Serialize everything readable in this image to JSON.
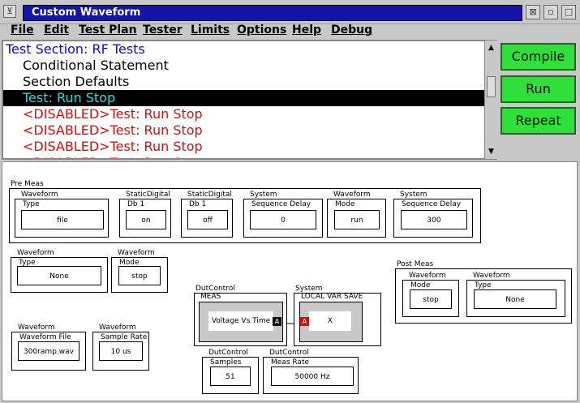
{
  "window": {
    "title": "Custom Waveform"
  },
  "menu": [
    "File",
    "Edit",
    "Test Plan",
    "Tester",
    "Limits",
    "Options",
    "Help",
    "Debug"
  ],
  "tree": [
    {
      "label": "Test Section: RF Tests",
      "color": "#0a0ad0",
      "indent": 0,
      "selected": false
    },
    {
      "label": "Conditional Statement",
      "color": "#000000",
      "indent": 1,
      "selected": false
    },
    {
      "label": "Section Defaults",
      "color": "#000000",
      "indent": 1,
      "selected": false
    },
    {
      "label": "Test: Run Stop",
      "color": "#2fd8d8",
      "indent": 1,
      "selected": true
    },
    {
      "label": "<DISABLED>Test: Run Stop",
      "color": "#d01010",
      "indent": 1,
      "selected": false
    },
    {
      "label": "<DISABLED>Test: Run Stop",
      "color": "#d01010",
      "indent": 1,
      "selected": false
    },
    {
      "label": "<DISABLED>Test: Run Stop",
      "color": "#d01010",
      "indent": 1,
      "selected": false
    },
    {
      "label": "<DISABLED>Test: Run Stop",
      "color": "#d01010",
      "indent": 1,
      "selected": false
    }
  ],
  "buttons": {
    "compile": "Compile",
    "run": "Run",
    "repeat": "Repeat"
  },
  "canvas": {
    "pre_meas_label": "Pre Meas",
    "post_meas_label": "Post Meas",
    "pre_meas": [
      {
        "group": "Waveform",
        "field": "Type",
        "value": "file"
      },
      {
        "group": "StaticDigital",
        "field": "Db 1",
        "value": "on"
      },
      {
        "group": "StaticDigital",
        "field": "Db 1",
        "value": "off"
      },
      {
        "group": "System",
        "field": "Sequence Delay",
        "value": "0"
      },
      {
        "group": "Waveform",
        "field": "Mode",
        "value": "run"
      },
      {
        "group": "System",
        "field": "Sequence Delay",
        "value": "300"
      }
    ],
    "mid_left": [
      {
        "group": "Waveform",
        "field": "Type",
        "value": "None"
      },
      {
        "group": "Waveform",
        "field": "Mode",
        "value": "stop"
      }
    ],
    "bottom_left": [
      {
        "group": "Waveform",
        "field": "Waveform File",
        "value": "300ramp.wav"
      },
      {
        "group": "Waveform",
        "field": "Sample Rate",
        "value": "10 us"
      }
    ],
    "meas": {
      "group": "DutControl",
      "field": "MEAS",
      "value": "Voltage Vs Time",
      "port": "A"
    },
    "local": {
      "group": "System",
      "field": "LOCAL VAR SAVE",
      "value": "X",
      "port": "A"
    },
    "samples": {
      "group": "DutControl",
      "field": "Samples",
      "value": "51"
    },
    "meas_rate": {
      "group": "DutControl",
      "field": "Meas Rate",
      "value": "50000 Hz"
    },
    "post_meas": [
      {
        "group": "Waveform",
        "field": "Mode",
        "value": "stop"
      },
      {
        "group": "Waveform",
        "field": "Type",
        "value": "None"
      }
    ]
  }
}
